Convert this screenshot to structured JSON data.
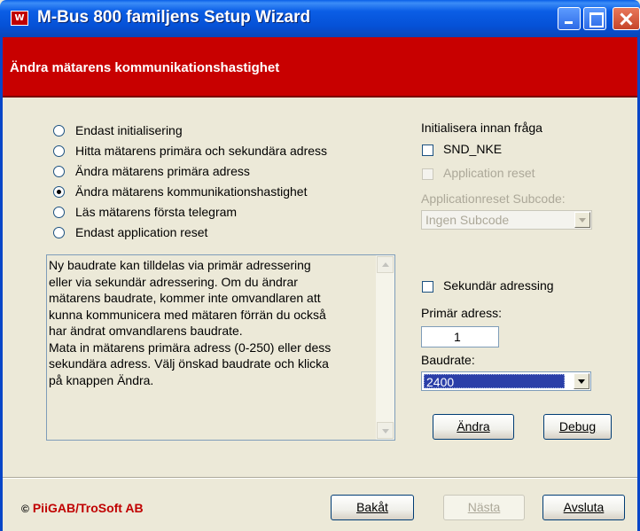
{
  "window": {
    "title": "M-Bus 800 familjens Setup Wizard",
    "icon_text": "W"
  },
  "banner": {
    "heading": "Ändra mätarens kommunikationshastighet"
  },
  "options": [
    {
      "label": "Endast initialisering",
      "checked": false
    },
    {
      "label": "Hitta mätarens primära och sekundära adress",
      "checked": false
    },
    {
      "label": "Ändra mätarens primära adress",
      "checked": false
    },
    {
      "label": "Ändra mätarens kommunikationshastighet",
      "checked": true
    },
    {
      "label": "Läs mätarens första telegram",
      "checked": false
    },
    {
      "label": "Endast application reset",
      "checked": false
    }
  ],
  "info": {
    "lines": [
      "Ny baudrate kan tilldelas via primär adressering",
      "eller via sekundär adressering. Om du ändrar",
      "mätarens baudrate, kommer inte omvandlaren att",
      "kunna kommunicera med mätaren förrän du också",
      "har ändrat omvandlarens baudrate.",
      "Mata in mätarens primära adress (0-250) eller dess",
      "sekundära adress. Välj önskad baudrate och klicka",
      "på knappen Ändra."
    ]
  },
  "init": {
    "heading": "Initialisera innan fråga",
    "snd_nke_label": "SND_NKE",
    "app_reset_label": "Application reset",
    "subcode_label": "Applicationreset Subcode:",
    "subcode_value": "Ingen Subcode"
  },
  "addressing": {
    "secondary_label": "Sekundär adressing",
    "primary_label": "Primär adress:",
    "primary_value": "1",
    "baudrate_label": "Baudrate:",
    "baudrate_value": "2400"
  },
  "buttons": {
    "change": "Ändra",
    "debug": "Debug",
    "back": "Bakåt",
    "next": "Nästa",
    "quit": "Avsluta"
  },
  "footer": {
    "copyright": "©",
    "brand": "PiiGAB",
    "rest": "/TroSoft AB"
  }
}
